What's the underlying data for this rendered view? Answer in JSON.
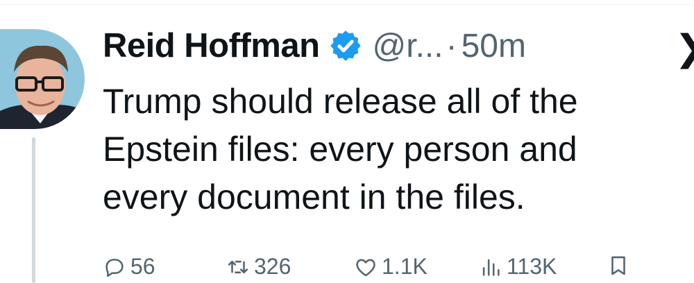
{
  "tweet": {
    "author": {
      "display_name": "Reid Hoffman",
      "handle": "@r...",
      "verified": true
    },
    "separator": "·",
    "time": "50m",
    "text": "Trump should release all of the\nEpstein files: every person and\nevery document in the files.",
    "more_glyph": "❯",
    "metrics": {
      "replies": "56",
      "reposts": "326",
      "likes": "1.1K",
      "views": "113K"
    }
  },
  "icons": {
    "verified": "verified-badge-icon",
    "reply": "reply-icon",
    "repost": "repost-icon",
    "like": "heart-icon",
    "views": "views-icon",
    "bookmark": "bookmark-icon",
    "more": "chevron-right-icon"
  },
  "colors": {
    "text": "#0f1419",
    "secondary": "#536471",
    "verified": "#1d9bf0",
    "thread_line": "#cfd9de"
  }
}
